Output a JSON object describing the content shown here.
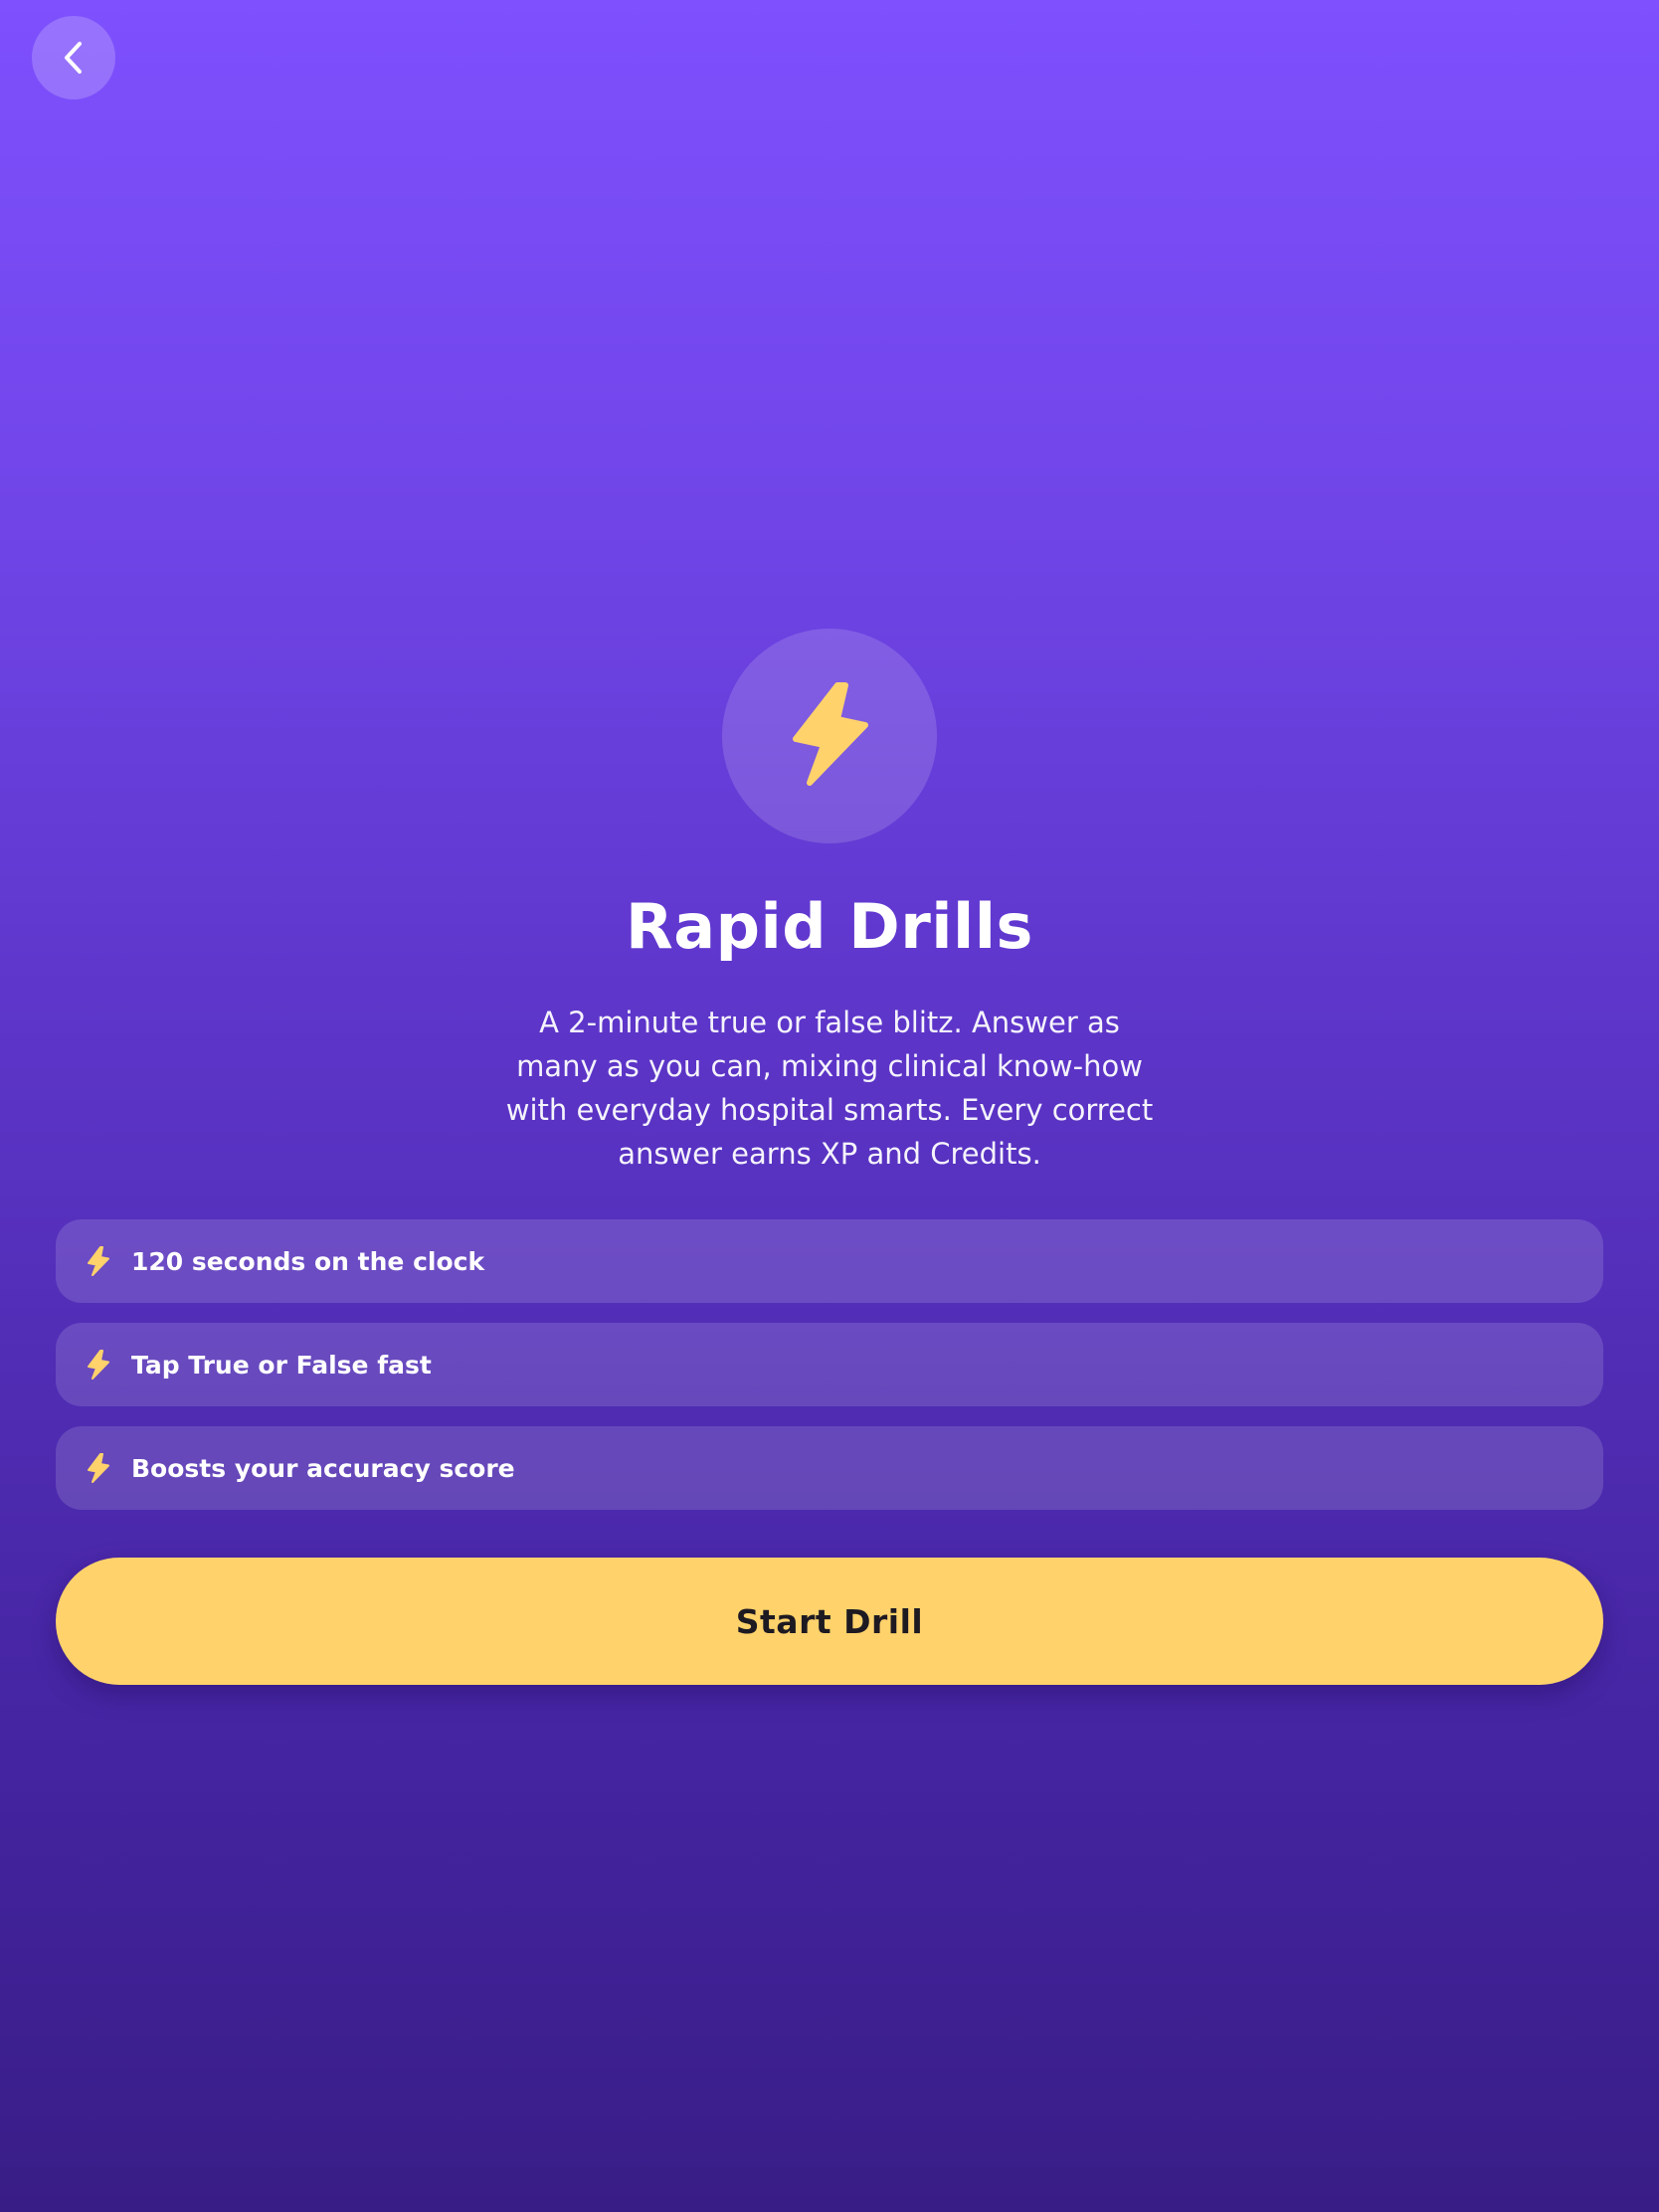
{
  "back": {
    "icon": "chevron-left-icon"
  },
  "hero": {
    "icon": "lightning-bolt-icon",
    "accent_color": "#ffd26b"
  },
  "title": "Rapid Drills",
  "description": "A 2-minute true or false blitz. Answer as many as you can, mixing clinical know-how with everyday hospital smarts. Every correct answer earns XP and Credits.",
  "features": [
    {
      "icon": "lightning-bolt-icon",
      "label": "120 seconds on the clock"
    },
    {
      "icon": "lightning-bolt-icon",
      "label": "Tap True or False fast"
    },
    {
      "icon": "lightning-bolt-icon",
      "label": "Boosts your accuracy score"
    }
  ],
  "start_button": {
    "label": "Start Drill",
    "color": "#ffd26b"
  },
  "colors": {
    "background_top": "#7e50fe",
    "background_bottom": "#391d86",
    "text": "#ffffff",
    "button_text": "#1e1a22"
  }
}
